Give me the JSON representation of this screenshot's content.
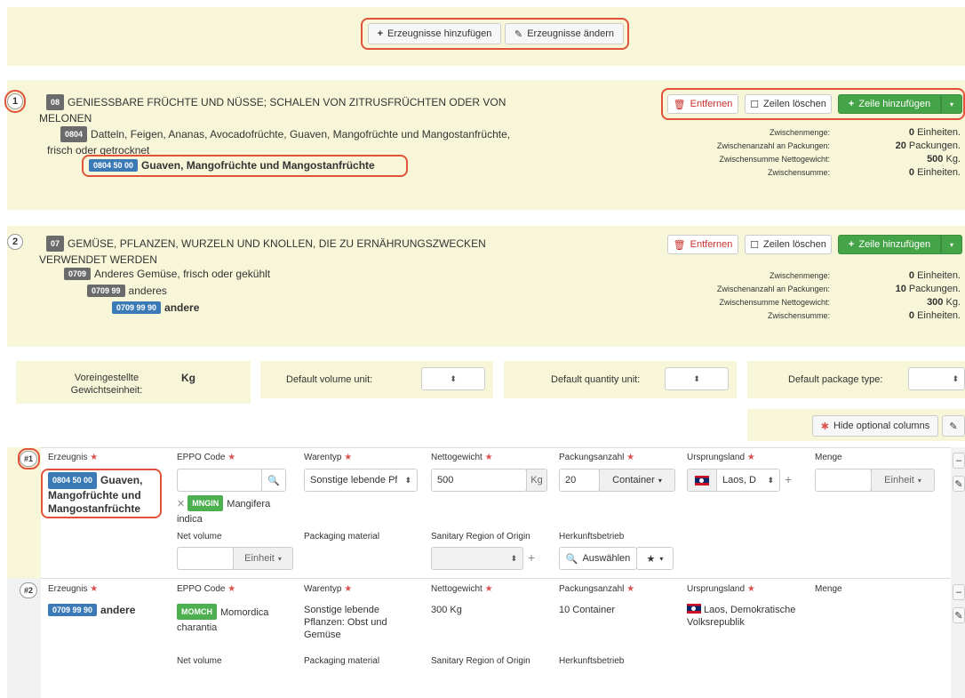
{
  "toolbar": {
    "add_products": "Erzeugnisse hinzufügen",
    "edit_products": "Erzeugnisse ändern"
  },
  "sections": [
    {
      "num": "1",
      "chapter_code": "08",
      "chapter_title_1": "GENIESSBARE FRÜCHTE UND NÜSSE; SCHALEN VON ZITRUSFRÜCHTEN ODER VON",
      "chapter_title_2": "MELONEN",
      "heading_code": "0804",
      "heading_title_1": "Datteln, Feigen, Ananas, Avocadofrüchte, Guaven, Mangofrüchte und Mangostanfrüchte,",
      "heading_title_2": "frisch oder getrocknet",
      "cn_code": "0804 50 00",
      "cn_title": "Guaven, Mangofrüchte und Mangostanfrüchte",
      "remove": "Entfernen",
      "clear_rows": "Zeilen löschen",
      "add_row": "Zeile hinzufügen",
      "labels": [
        "Zwischenmenge:",
        "Zwischenanzahl an Packungen:",
        "Zwischensumme Nettogewicht:",
        "Zwischensumme:"
      ],
      "values": [
        {
          "num": "0",
          "unit": "Einheiten."
        },
        {
          "num": "20",
          "unit": "Packungen."
        },
        {
          "num": "500",
          "unit": "Kg."
        },
        {
          "num": "0",
          "unit": "Einheiten."
        }
      ]
    },
    {
      "num": "2",
      "chapter_code": "07",
      "chapter_title_1": "GEMÜSE, PFLANZEN, WURZELN UND KNOLLEN, DIE ZU ERNÄHRUNGSZWECKEN",
      "chapter_title_2": "VERWENDET WERDEN",
      "heading_code": "0709",
      "heading_title": "Anderes Gemüse, frisch oder gekühlt",
      "sub_code": "0709 99",
      "sub_title": "anderes",
      "cn_code": "0709 99 90",
      "cn_title": "andere",
      "remove": "Entfernen",
      "clear_rows": "Zeilen löschen",
      "add_row": "Zeile hinzufügen",
      "labels": [
        "Zwischenmenge:",
        "Zwischenanzahl an Packungen:",
        "Zwischensumme Nettogewicht:",
        "Zwischensumme:"
      ],
      "values": [
        {
          "num": "0",
          "unit": "Einheiten."
        },
        {
          "num": "10",
          "unit": "Packungen."
        },
        {
          "num": "300",
          "unit": "Kg."
        },
        {
          "num": "0",
          "unit": "Einheiten."
        }
      ]
    }
  ],
  "defaults": {
    "weight_label_1": "Voreingestellte",
    "weight_label_2": "Gewichtseinheit:",
    "weight_value": "Kg",
    "volume_label": "Default volume unit:",
    "quantity_label": "Default quantity unit:",
    "package_label": "Default package type:",
    "hide_optional": "Hide optional columns"
  },
  "rows": [
    {
      "num": "#1",
      "h_product": "Erzeugnis",
      "h_eppo": "EPPO Code",
      "h_type": "Warentyp",
      "h_weight": "Nettogewicht",
      "h_packages": "Packungsanzahl",
      "h_origin": "Ursprungsland",
      "h_quantity": "Menge",
      "product_code": "0804 50 00",
      "product_title_1": "Guaven,",
      "product_title_2": "Mangofrüchte und",
      "product_title_3": "Mangostanfrüchte",
      "eppo_tag": "MNGIN",
      "eppo_name_1": "Mangifera",
      "eppo_name_2": "indica",
      "type_value": "Sonstige lebende Pf",
      "weight_value": "500",
      "weight_unit": "Kg",
      "packages_value": "20",
      "package_type": "Container",
      "origin_value": "Laos, D",
      "quantity_unit": "Einheit",
      "h_net_volume": "Net volume",
      "h_pack_material": "Packaging material",
      "h_sanitary": "Sanitary Region of Origin",
      "h_establishment": "Herkunftsbetrieb",
      "volume_unit": "Einheit",
      "select_button": "Auswählen"
    },
    {
      "num": "#2",
      "h_product": "Erzeugnis",
      "h_eppo": "EPPO Code",
      "h_type": "Warentyp",
      "h_weight": "Nettogewicht",
      "h_packages": "Packungsanzahl",
      "h_origin": "Ursprungsland",
      "h_quantity": "Menge",
      "product_code": "0709 99 90",
      "product_title": "andere",
      "eppo_tag": "MOMCH",
      "eppo_name_1": "Momordica",
      "eppo_name_2": "charantia",
      "type_1": "Sonstige lebende",
      "type_2": "Pflanzen: Obst und",
      "type_3": "Gemüse",
      "weight": "300 Kg",
      "packages": "10 Container",
      "origin_1": "Laos, Demokratische",
      "origin_2": "Volksrepublik",
      "h_net_volume": "Net volume",
      "h_pack_material": "Packaging material",
      "h_sanitary": "Sanitary Region of Origin",
      "h_establishment": "Herkunftsbetrieb"
    }
  ],
  "colors": {
    "panel": "#f8f6d8",
    "green": "#45a447",
    "blue_tag": "#3a7ab7",
    "grey_tag": "#6b6b6b",
    "annotation": "#e0533a"
  }
}
